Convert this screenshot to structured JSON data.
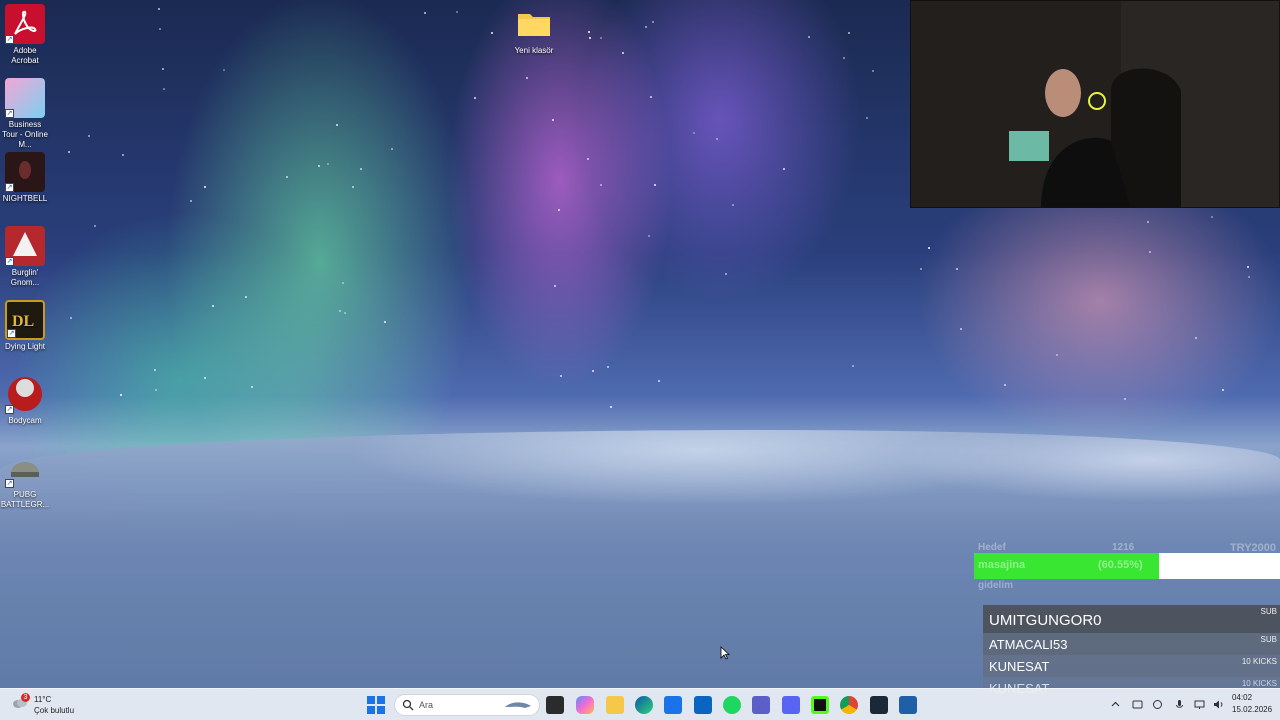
{
  "desktop": {
    "icons": [
      {
        "label": "Adobe Acrobat",
        "icon": "adobe-acrobat-icon",
        "color": "#c8102e"
      },
      {
        "label": "Business Tour - Online M...",
        "icon": "business-tour-icon",
        "color": "#e24a9a"
      },
      {
        "label": "NIGHTBELL",
        "icon": "nightbell-icon",
        "color": "#3a1c1c"
      },
      {
        "label": "Burglin' Gnom...",
        "icon": "burglin-gnomes-icon",
        "color": "#b5282d"
      },
      {
        "label": "Dying Light",
        "icon": "dying-light-icon",
        "color": "#c99a1d"
      },
      {
        "label": "Bodycam",
        "icon": "bodycam-icon",
        "color": "#b81c1c"
      },
      {
        "label": "PUBG BATTLEGR...",
        "icon": "pubg-icon",
        "color": "#8a8f85"
      }
    ],
    "folder": {
      "label": "Yeni klasör",
      "icon": "folder-icon",
      "color": "#f5c84a"
    }
  },
  "webcam": {
    "label": "webcam-overlay"
  },
  "goal": {
    "top_left": "Hedef",
    "top_mid": "1216",
    "top_right": "TRY2000",
    "label": "masajina",
    "percent_text": "(60.55%)",
    "progress": 0.6055,
    "below": "gidelim",
    "fill_color": "#39e631"
  },
  "events": [
    {
      "name": "UMITGUNGOR0",
      "tag": "SUB"
    },
    {
      "name": "ATMACALI53",
      "tag": "SUB"
    },
    {
      "name": "KUNESAT",
      "tag": "10 KICKS"
    },
    {
      "name": "KUNESAT",
      "tag": "10 KICKS"
    }
  ],
  "taskbar": {
    "weather": {
      "temp": "11°C",
      "condition": "Çok bulutlu",
      "badge": "3"
    },
    "search_placeholder": "Ara",
    "pinned": [
      "task-view-icon",
      "copilot-icon",
      "file-explorer-icon",
      "edge-icon",
      "store-icon",
      "outlook-icon",
      "spotify-icon",
      "teams-icon",
      "discord-icon",
      "kick-icon",
      "chrome-icon",
      "steam-icon",
      "app-icon"
    ],
    "clock": {
      "time": "04:02",
      "date": "15.02.2026"
    }
  }
}
